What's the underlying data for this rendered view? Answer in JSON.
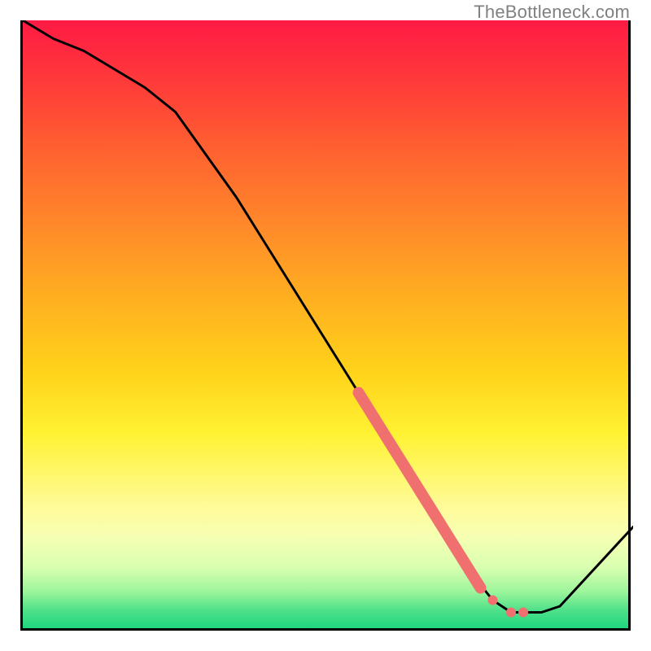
{
  "watermark": "TheBottleneck.com",
  "chart_data": {
    "type": "line",
    "title": "",
    "xlabel": "",
    "ylabel": "",
    "xlim": [
      0,
      100
    ],
    "ylim": [
      0,
      100
    ],
    "series": [
      {
        "name": "curve",
        "x": [
          0,
          5,
          10,
          15,
          20,
          25,
          30,
          35,
          40,
          45,
          50,
          55,
          60,
          63,
          65,
          68,
          70,
          73,
          77,
          80,
          83,
          85,
          88,
          100
        ],
        "values": [
          100,
          97,
          95,
          92,
          89,
          85,
          78,
          71,
          63,
          55,
          47,
          39,
          31,
          26,
          23,
          18,
          15,
          10,
          5,
          3,
          3,
          3,
          4,
          17
        ]
      }
    ],
    "highlight_band": {
      "description": "pink emphasized segment on the descending curve",
      "x_start": 55,
      "x_end": 75,
      "values_start": 39,
      "values_end": 7
    },
    "highlight_dots": [
      {
        "x": 77,
        "y": 5
      },
      {
        "x": 80,
        "y": 3
      },
      {
        "x": 82,
        "y": 3
      }
    ],
    "colors": {
      "curve": "#000000",
      "highlight": "#f07070",
      "gradient_top": "#ff1a44",
      "gradient_mid": "#ffd31a",
      "gradient_bottom": "#1fd67f"
    }
  }
}
